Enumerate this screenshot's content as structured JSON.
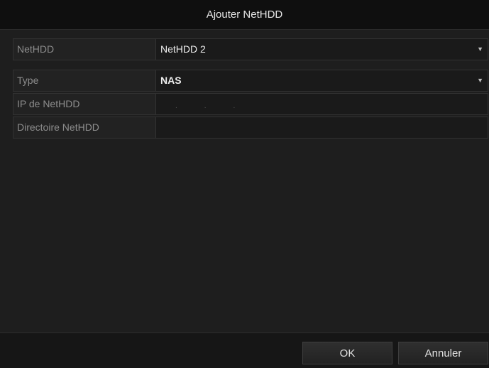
{
  "dialog": {
    "title": "Ajouter NetHDD"
  },
  "form": {
    "nethdd": {
      "label": "NetHDD",
      "value": "NetHDD 2",
      "icon": "chevron-down-icon"
    },
    "type": {
      "label": "Type",
      "value": "NAS",
      "icon": "chevron-down-icon"
    },
    "ip": {
      "label": "IP de NetHDD",
      "value": ""
    },
    "directory": {
      "label": "Directoire NetHDD",
      "value": ""
    }
  },
  "buttons": {
    "ok_label": "OK",
    "cancel_label": "Annuler"
  },
  "colors": {
    "dialog_background": "#1c1c1c",
    "title_bar": "#0f0f0f",
    "text": "#ececec",
    "label_text": "#8d8d8d"
  }
}
